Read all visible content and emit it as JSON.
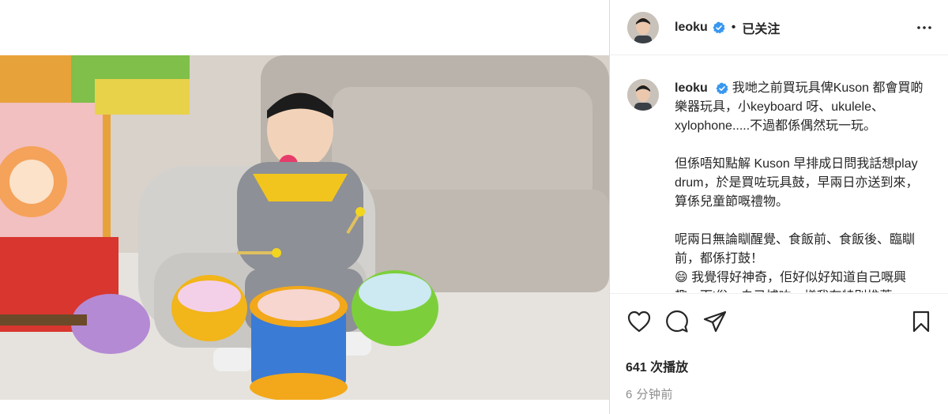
{
  "post": {
    "username": "leoku",
    "follow_state": "已关注",
    "separator": "•",
    "verified": true
  },
  "caption": {
    "username": "leoku",
    "paragraphs": [
      "我哋之前買玩具俾Kuson 都會買啲樂器玩具，小keyboard 呀、ukulele、xylophone.....不過都係偶然玩一玩。",
      "但係唔知點解 Kuson 早排成日問我話想play drum，於是買咗玩具鼓，早兩日亦送到來，算係兒童節嘅禮物。",
      "呢兩日無論瞓醒覺、食飯前、食飯後、臨瞓前，都係打鼓！",
      "😄 我覺得好神奇，佢好似好知道自己嘅興趣，而’俗，自己捕咗，樣我有特別推薦"
    ]
  },
  "stats": {
    "views": "641 次播放",
    "time_ago": "6 分钟前"
  },
  "icons": {
    "like": "heart-icon",
    "comment": "comment-icon",
    "share": "paper-plane-icon",
    "save": "bookmark-icon",
    "more": "more-horizontal-icon",
    "verified": "verified-badge-icon"
  },
  "colors": {
    "verified_blue": "#3897f0",
    "text": "#262626",
    "muted": "#8e8e8e",
    "border": "#dbdbdb"
  }
}
